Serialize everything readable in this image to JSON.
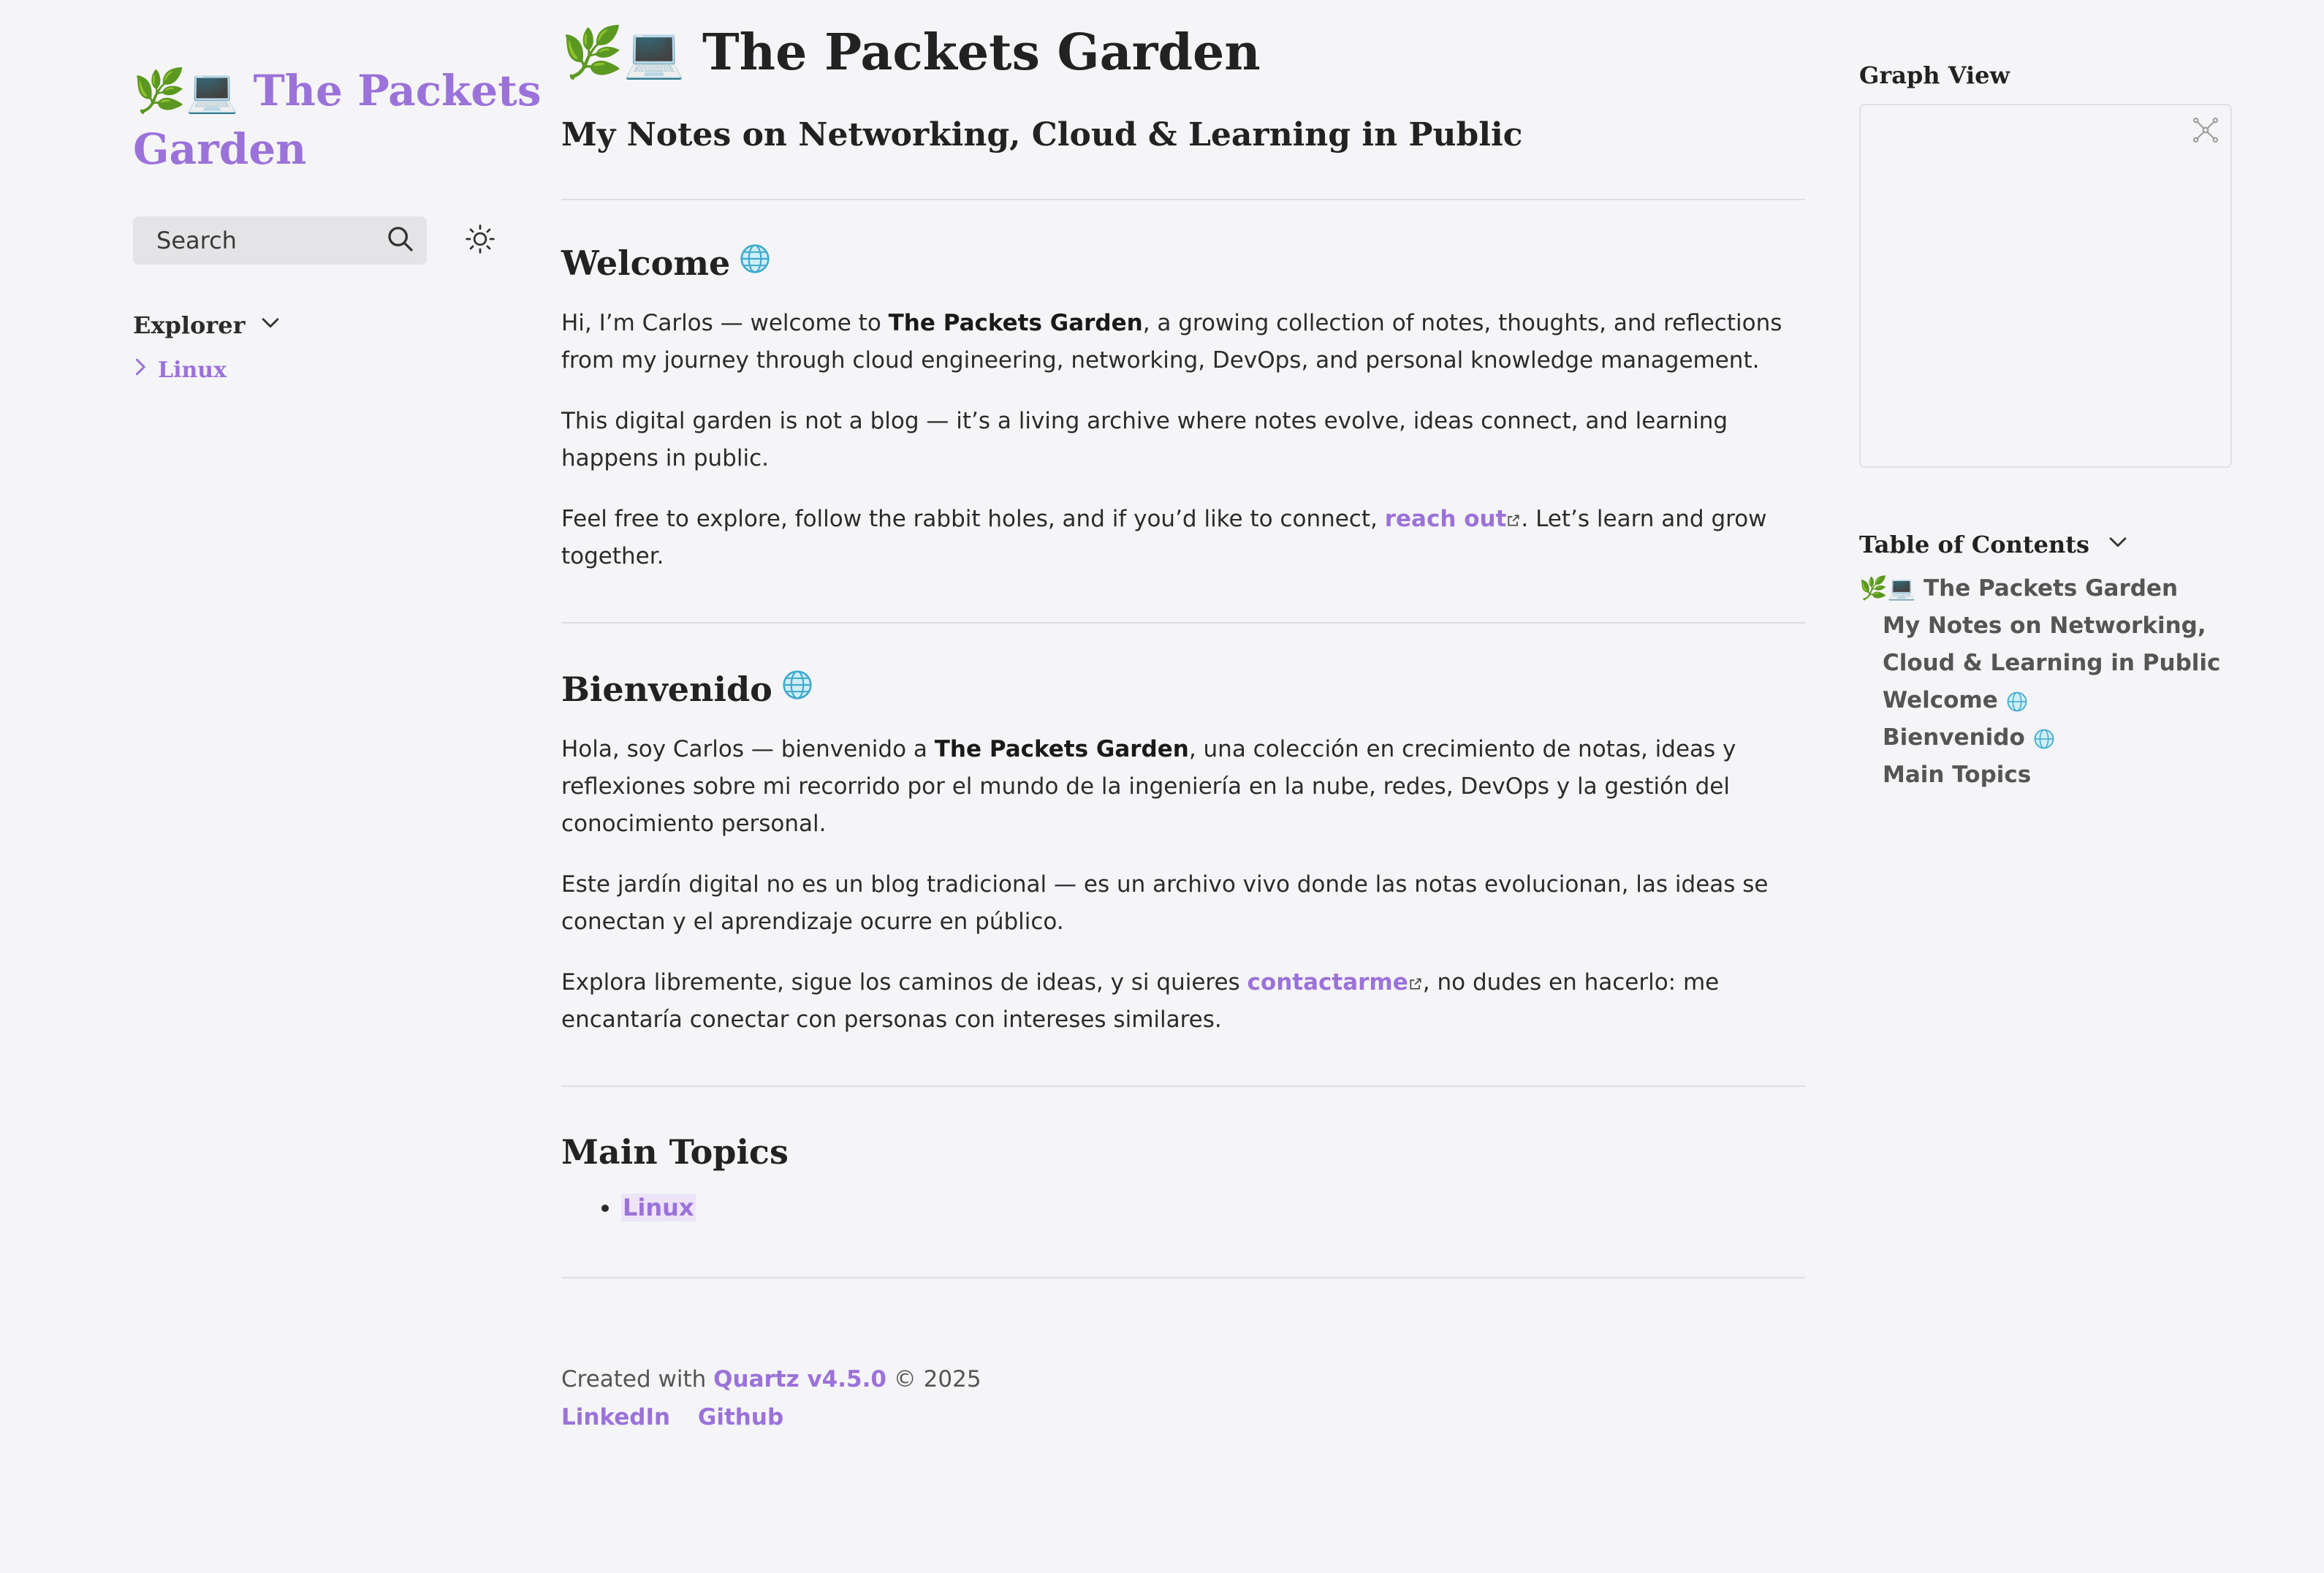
{
  "sidebar": {
    "site_emoji": "🌿💻",
    "site_title_line1": "The Packets",
    "site_title_line2": "Garden",
    "search_placeholder": "Search",
    "explorer_label": "Explorer",
    "explorer_items": [
      {
        "label": "Linux"
      }
    ]
  },
  "main": {
    "title_emoji": "🌿💻",
    "title": "The Packets Garden",
    "subtitle": "My Notes on Networking, Cloud & Learning in Public",
    "welcome": {
      "heading": "Welcome",
      "p1_a": "Hi, I’m Carlos — welcome to ",
      "p1_bold": "The Packets Garden",
      "p1_b": ", a growing collection of notes, thoughts, and reflections from my journey through cloud engineering, networking, DevOps, and personal knowledge management.",
      "p2": "This digital garden is not a blog — it’s a living archive where notes evolve, ideas connect, and learning happens in public.",
      "p3_a": "Feel free to explore, follow the rabbit holes, and if you’d like to connect, ",
      "p3_link": "reach out",
      "p3_b": ". Let’s learn and grow together."
    },
    "bienvenido": {
      "heading": "Bienvenido",
      "p1_a": "Hola, soy Carlos — bienvenido a ",
      "p1_bold": "The Packets Garden",
      "p1_b": ", una colección en crecimiento de notas, ideas y reflexiones sobre mi recorrido por el mundo de la ingeniería en la nube, redes, DevOps y la gestión del conocimiento personal.",
      "p2": "Este jardín digital no es un blog tradicional — es un archivo vivo donde las notas evolucionan, las ideas se conectan y el aprendizaje ocurre en público.",
      "p3_a": "Explora libremente, sigue los caminos de ideas, y si quieres ",
      "p3_link": "contactarme",
      "p3_b": ", no dudes en hacerlo: me encantaría conectar con personas con intereses similares."
    },
    "topics": {
      "heading": "Main Topics",
      "items": [
        "Linux"
      ]
    },
    "footer": {
      "created_prefix": "Created with ",
      "quartz_link": "Quartz v4.5.0",
      "copyright": " © 2025",
      "links": [
        "LinkedIn",
        "Github"
      ]
    }
  },
  "right": {
    "graph_label": "Graph View",
    "toc_label": "Table of Contents",
    "toc_items": [
      {
        "text": "🌿💻 The Packets Garden",
        "level": 1
      },
      {
        "text": "My Notes on Networking, Cloud & Learning in Public",
        "level": 2
      },
      {
        "text": "Welcome",
        "level": 2
      },
      {
        "text": "Bienvenido",
        "level": 2
      },
      {
        "text": "Main Topics",
        "level": 2
      }
    ]
  },
  "colors": {
    "accent": "#9b72d9",
    "background": "#f5f5f7",
    "text": "#2b2b2b"
  }
}
